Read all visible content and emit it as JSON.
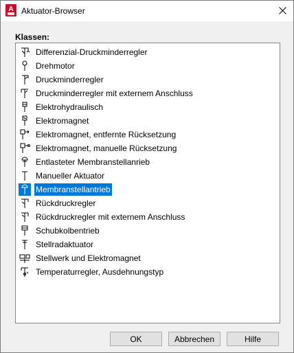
{
  "window": {
    "title": "Aktuator-Browser",
    "app_icon_letter": "A"
  },
  "list": {
    "label": "Klassen:",
    "selected_index": 10,
    "items": [
      {
        "label": "Differenzial-Druckminderregler",
        "icon": "differential-pressure-regulator-icon"
      },
      {
        "label": "Drehmotor",
        "icon": "rotary-motor-icon"
      },
      {
        "label": "Druckminderregler",
        "icon": "pressure-reducing-regulator-icon"
      },
      {
        "label": "Druckminderregler mit externem Anschluss",
        "icon": "pressure-regulator-external-icon"
      },
      {
        "label": "Elektrohydraulisch",
        "icon": "electrohydraulic-icon"
      },
      {
        "label": "Elektromagnet",
        "icon": "solenoid-icon"
      },
      {
        "label": "Elektromagnet, entfernte Rücksetzung",
        "icon": "solenoid-remote-reset-icon"
      },
      {
        "label": "Elektromagnet, manuelle Rücksetzung",
        "icon": "solenoid-manual-reset-icon"
      },
      {
        "label": "Entlasteter Membranstellanrieb",
        "icon": "balanced-diaphragm-icon"
      },
      {
        "label": "Manueller Aktuator",
        "icon": "manual-actuator-icon"
      },
      {
        "label": "Membranstellantrieb",
        "icon": "diaphragm-actuator-icon"
      },
      {
        "label": "Rückdruckregler",
        "icon": "back-pressure-regulator-icon"
      },
      {
        "label": "Rückdruckregler mit externem Anschluss",
        "icon": "back-pressure-external-icon"
      },
      {
        "label": "Schubkolbentrieb",
        "icon": "piston-actuator-icon"
      },
      {
        "label": "Stellradaktuator",
        "icon": "handwheel-actuator-icon"
      },
      {
        "label": "Stellwerk und Elektromagnet",
        "icon": "positioner-solenoid-icon"
      },
      {
        "label": "Temperaturregler, Ausdehnungstyp",
        "icon": "temperature-regulator-icon"
      }
    ]
  },
  "buttons": {
    "ok": "OK",
    "cancel": "Abbrechen",
    "help": "Hilfe"
  },
  "colors": {
    "selection": "#0078d7",
    "app_icon_bg": "#c8102e"
  }
}
